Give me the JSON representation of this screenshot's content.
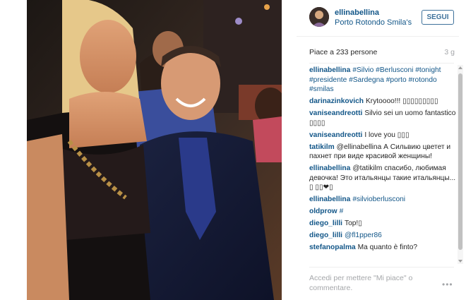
{
  "post": {
    "username": "ellinabellina",
    "location": "Porto Rotondo Smila's",
    "follow_label": "SEGUI",
    "likes_text": "Piace a 233 persone",
    "age": "3 g",
    "comment_placeholder": "Accedi per mettere \"Mi piace\" o commentare.",
    "more_label": "•••"
  },
  "comments": [
    {
      "author": "ellinabellina",
      "text": "#Silvio #Berlusconi #tonight #presidente #Sardegna #porto #rotondo #smilas"
    },
    {
      "author": "darinazinkovich",
      "text": "Krytoooo!!! ▯▯▯▯▯▯▯▯▯"
    },
    {
      "author": "vaniseandreotti",
      "text": "Silvio sei un uomo fantastico ▯▯▯▯"
    },
    {
      "author": "vaniseandreotti",
      "text": "I love you ▯▯▯"
    },
    {
      "author": "tatikilm",
      "text": "@ellinabellina А Сильвию цветет и пахнет при виде красивой женщины!"
    },
    {
      "author": "ellinabellina",
      "text": "@tatikilm спасибо, любимая девочка! Это итальянцы такие итальянцы... ▯ ▯▯❤▯"
    },
    {
      "author": "ellinabellina",
      "text": "#silvioberlusconi"
    },
    {
      "author": "oldprow",
      "text": "#"
    },
    {
      "author": "diego_lilli",
      "text": "Top!▯"
    },
    {
      "author": "diego_lilli",
      "text": "@fl1pper86"
    },
    {
      "author": "stefanopalma",
      "text": "Ma quanto è finto?"
    }
  ],
  "colors": {
    "link": "#125688",
    "follow_border": "#3f729b",
    "muted": "#a5a7aa"
  }
}
